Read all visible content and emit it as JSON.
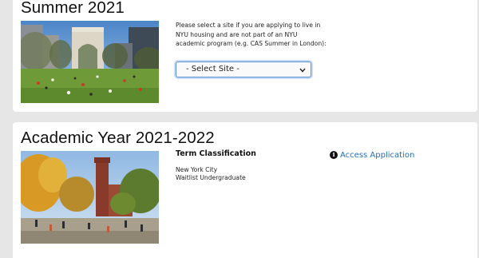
{
  "summer": {
    "title": "Summer 2021",
    "prompt": "Please select a site if you are applying to live in NYU housing and are not part of an NYU academic program (e.g. CAS Summer in London):",
    "select_value": "- Select Site -"
  },
  "academic": {
    "title": "Academic Year 2021-2022",
    "term_label": "Term Classification",
    "term_lines": [
      "New York City",
      "Waitlist Undergraduate"
    ],
    "access_label": "Access Application"
  },
  "icons": {
    "info": "info-circle-icon",
    "dropdown": "chevron-down-icon"
  },
  "colors": {
    "link": "#1f6fb5",
    "focus_ring": "#5b8fd6",
    "page_bg": "#e6e6e6"
  }
}
